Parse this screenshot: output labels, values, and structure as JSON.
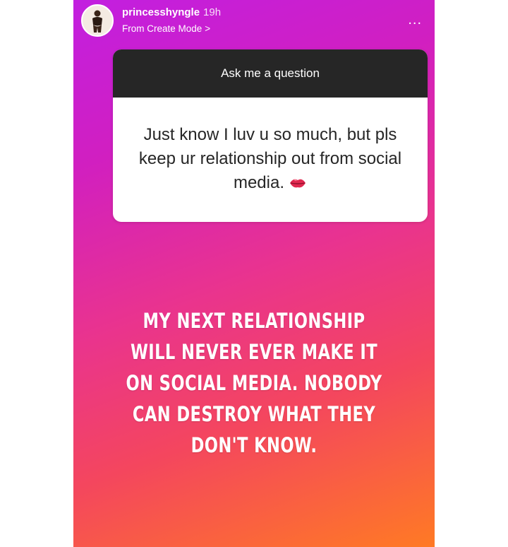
{
  "colors": {
    "gradient_start": "#c21fe0",
    "gradient_end": "#ff7a24",
    "question_header_bg": "#262626",
    "text_white": "#ffffff"
  },
  "header": {
    "username": "princesshyngle",
    "timestamp": "19h",
    "source_label": "From Create Mode",
    "source_chevron": ">",
    "more_icon": "..."
  },
  "question_sticker": {
    "title": "Ask me a question",
    "question_text": "Just know I luv u so much, but pls  keep ur relationship out from social media.",
    "emoji": "kiss-mark"
  },
  "story_reply": {
    "text": "MY NEXT RELATIONSHIP WILL NEVER EVER MAKE IT ON SOCIAL MEDIA. NOBODY CAN DESTROY WHAT THEY DON'T KNOW."
  }
}
